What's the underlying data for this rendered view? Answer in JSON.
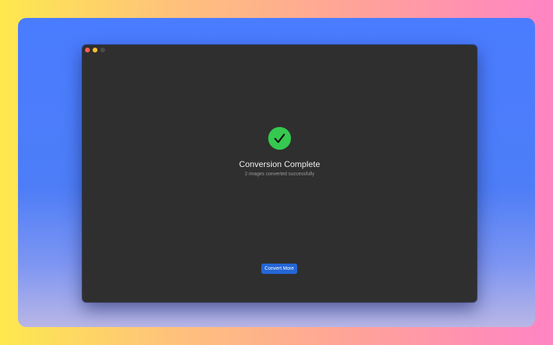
{
  "window": {
    "controls": [
      "close",
      "minimize",
      "zoom"
    ]
  },
  "status": {
    "icon": "checkmark-circle-icon",
    "icon_color": "#35c94f",
    "title": "Conversion Complete",
    "message": "2 images converted successfully"
  },
  "actions": {
    "convert_more_label": "Convert More",
    "accent_color": "#2466d6"
  }
}
